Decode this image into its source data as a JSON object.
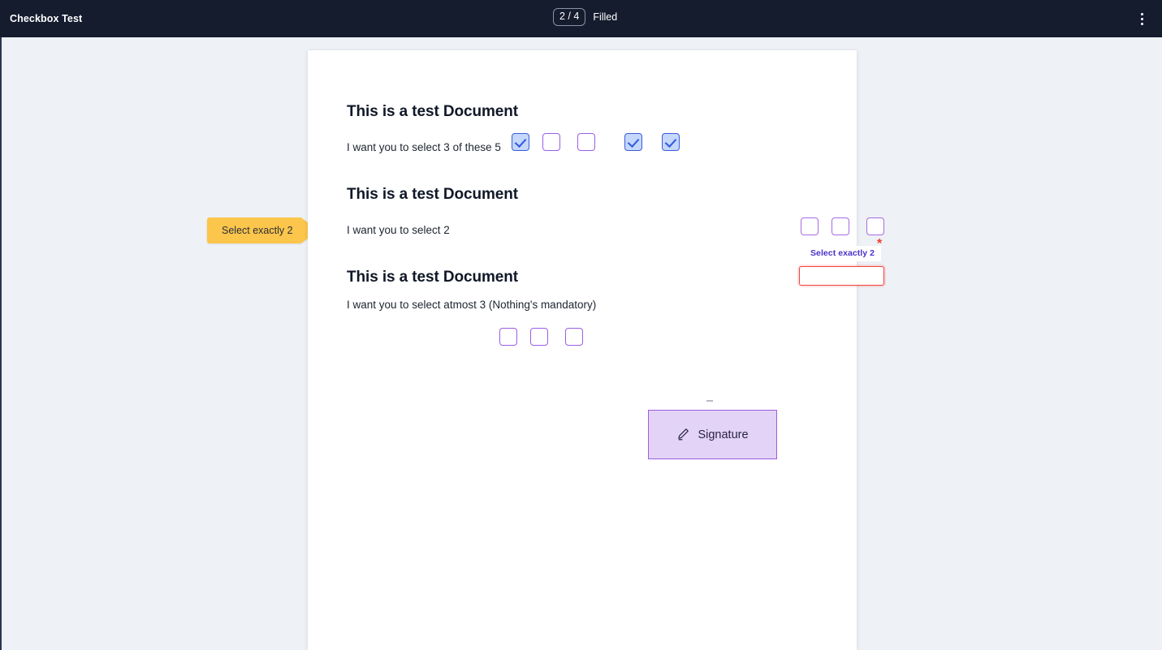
{
  "topbar": {
    "app_title": "Checkbox Test",
    "fill_count": "2 / 4",
    "fill_label": "Filled",
    "overflow_icon": "more-vertical-icon"
  },
  "callout": {
    "text": "Select exactly 2"
  },
  "document": {
    "sections": [
      {
        "heading": "This is a test Document",
        "prompt": "I want you to select 3 of these 5",
        "checkboxes": [
          {
            "checked": true
          },
          {
            "checked": false
          },
          {
            "checked": false
          },
          {
            "checked": true
          },
          {
            "checked": true
          }
        ]
      },
      {
        "heading": "This is a test Document",
        "prompt": "I want you to select 2",
        "required_marker": "*",
        "inline_hint": "Select exactly 2",
        "checkboxes": [
          {
            "checked": false
          },
          {
            "checked": false
          },
          {
            "checked": false
          }
        ]
      },
      {
        "heading": "This is a test Document",
        "prompt": "I want you to select atmost 3 (Nothing's mandatory)",
        "checkboxes": [
          {
            "checked": false
          },
          {
            "checked": false
          },
          {
            "checked": false
          }
        ]
      }
    ],
    "signature": {
      "label": "Signature",
      "icon": "pen-signature-icon"
    }
  },
  "colors": {
    "topbar_bg": "#151c2e",
    "page_bg": "#eef1f5",
    "doc_bg": "#ffffff",
    "checkbox_border": "#9b5de5",
    "checkbox_checked_bg": "#c5d7fb",
    "checkbox_checked_border": "#3b5bdb",
    "required_red": "#f4423a",
    "hint_purple": "#4a31c9",
    "callout_amber": "#fcc54b",
    "signature_bg": "#e2d3f7"
  }
}
